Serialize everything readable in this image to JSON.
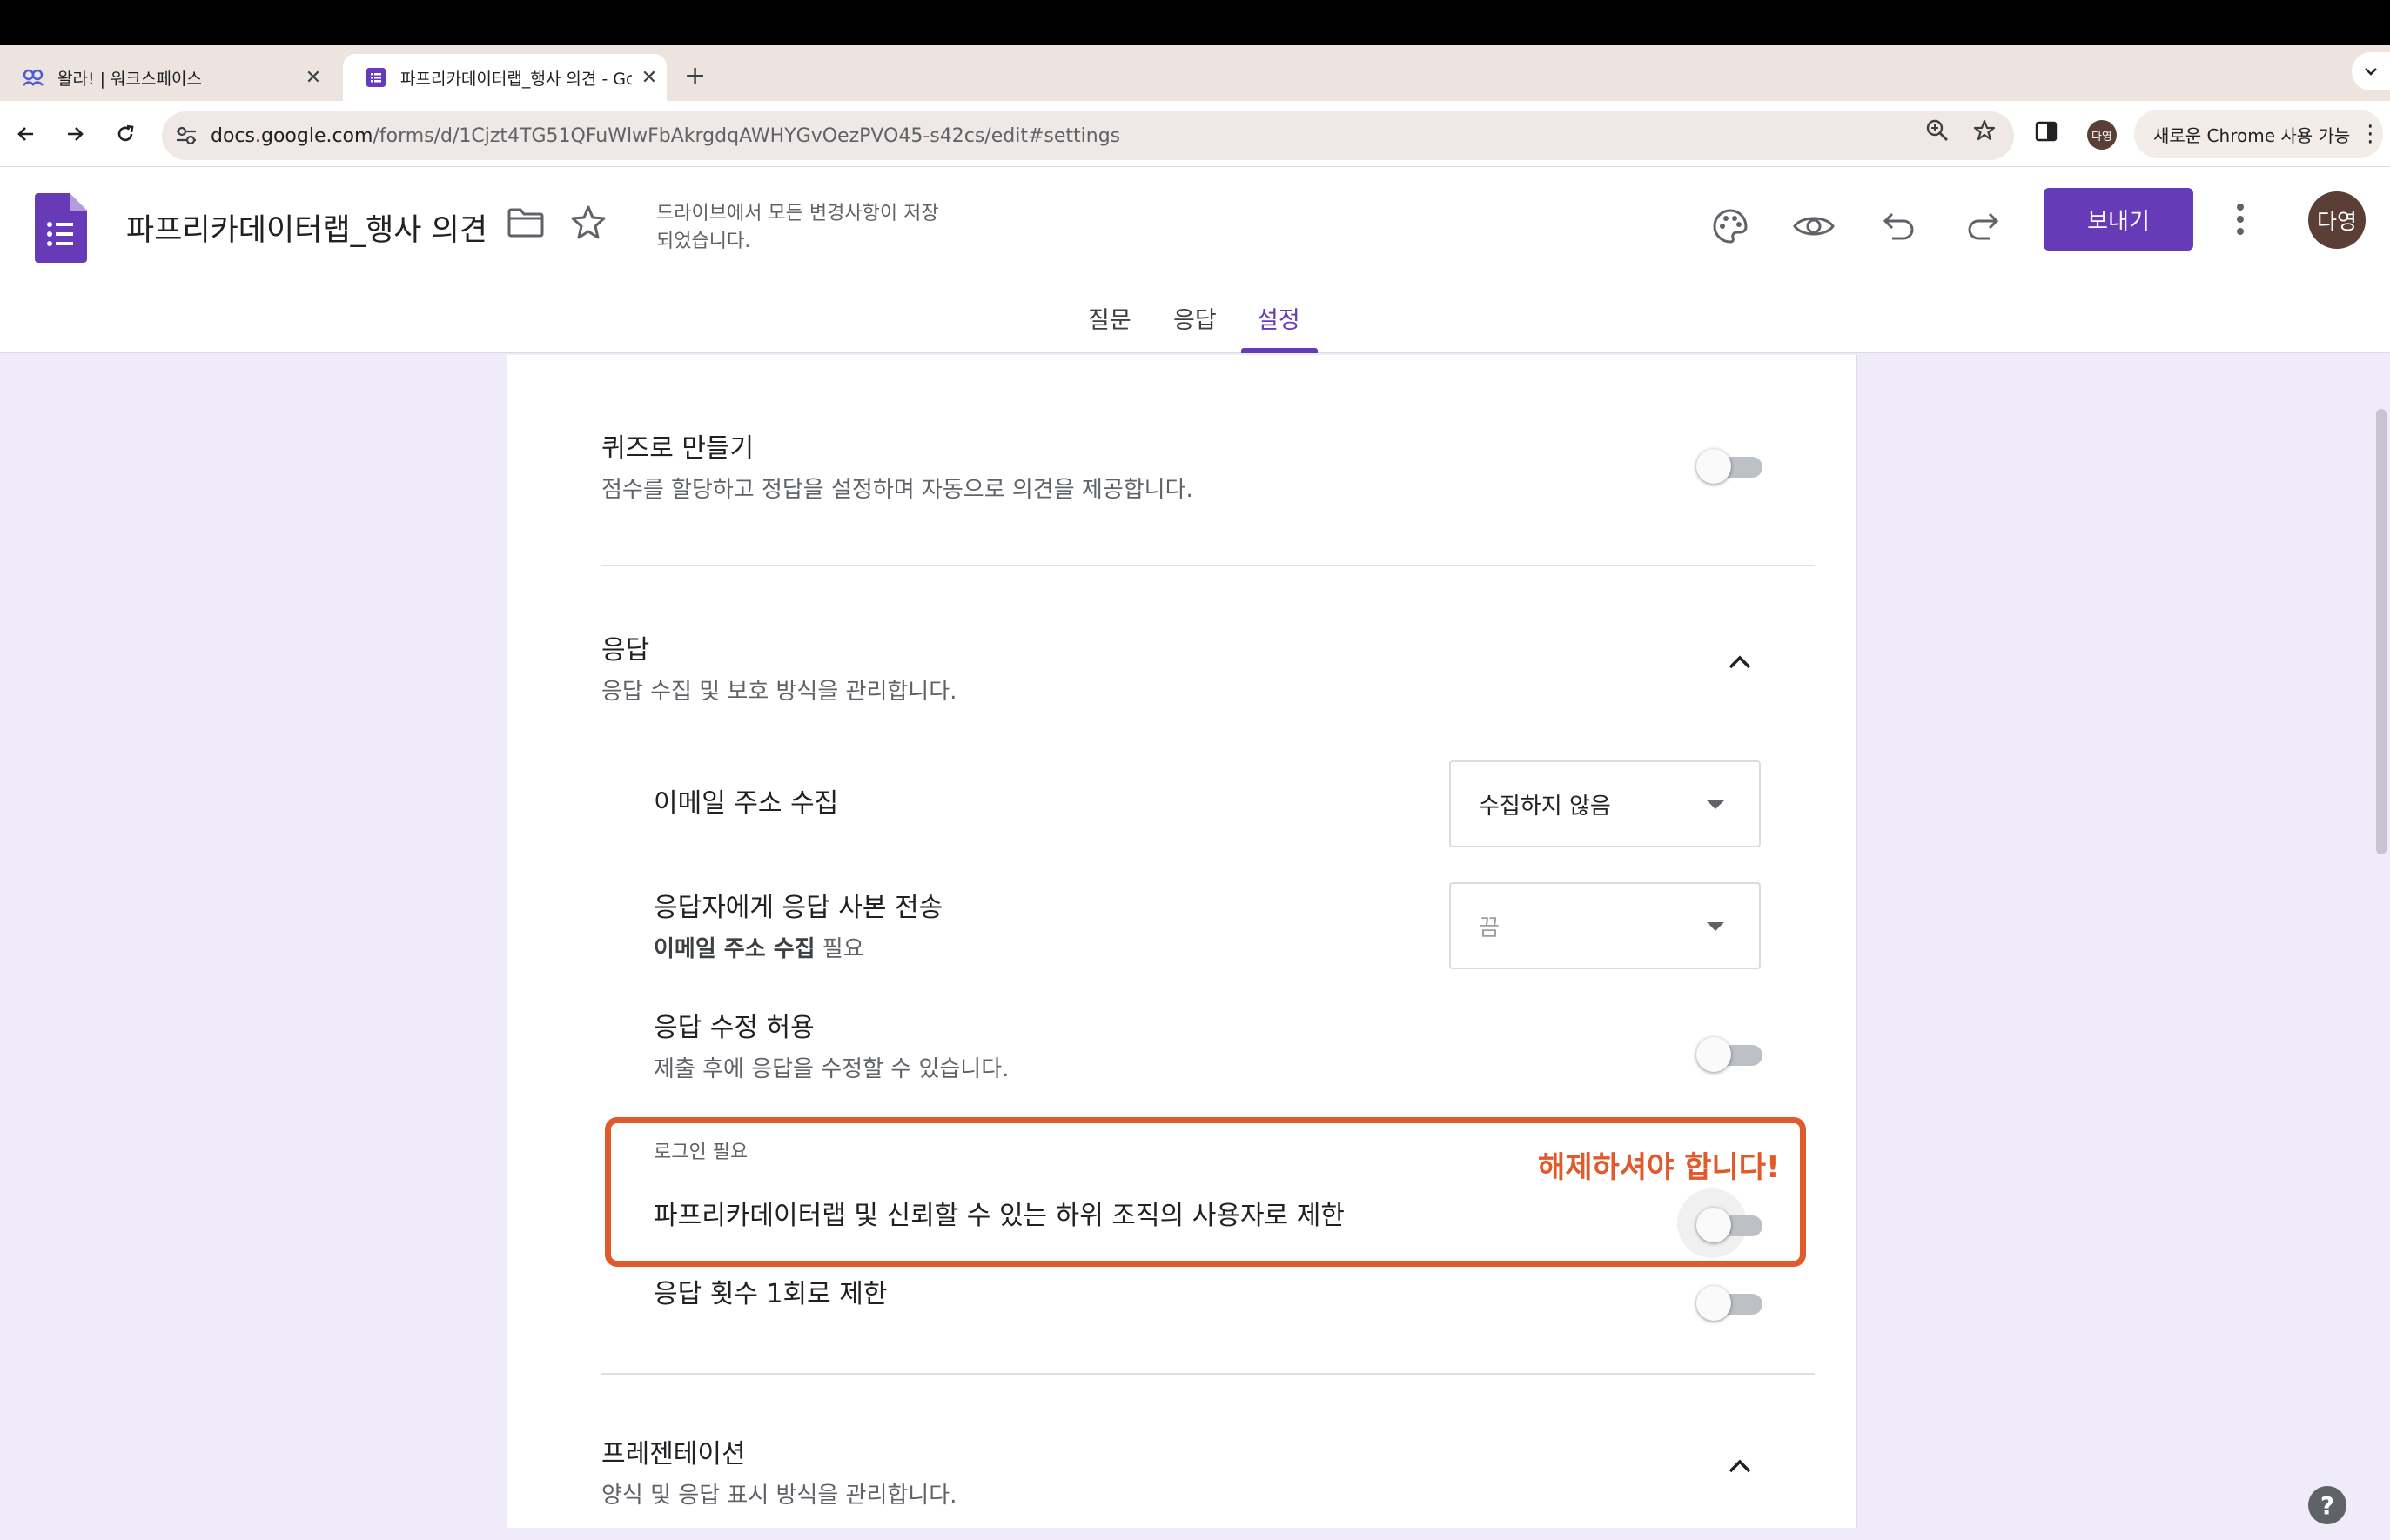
{
  "browser": {
    "tabs": [
      {
        "label": "왈라! | 워크스페이스",
        "icon": "workspace-icon"
      },
      {
        "label": "파프리카데이터랩_행사 의견 - Go",
        "icon": "google-forms-icon"
      }
    ],
    "url_domain": "docs.google.com",
    "url_path": "/forms/d/1Cjzt4TG51QFuWlwFbAkrgdqAWHYGvOezPVO45-s42cs/edit#settings",
    "profile_initials": "다영",
    "chrome_update_label": "새로운 Chrome 사용 가능"
  },
  "header": {
    "doc_title": "파프리카데이터랩_행사 의견",
    "saved_status": "드라이브에서 모든 변경사항이 저장되었습니다.",
    "send_label": "보내기",
    "avatar_initials": "다영",
    "tabs": [
      {
        "label": "질문"
      },
      {
        "label": "응답"
      },
      {
        "label": "설정",
        "active": true
      }
    ]
  },
  "settings": {
    "quiz": {
      "title": "퀴즈로 만들기",
      "description": "점수를 할당하고 정답을 설정하며 자동으로 의견을 제공합니다.",
      "enabled": false
    },
    "responses": {
      "title": "응답",
      "description": "응답 수집 및 보호 방식을 관리합니다.",
      "collect_email": {
        "label": "이메일 주소 수집",
        "value": "수집하지 않음"
      },
      "send_copy": {
        "label": "응답자에게 응답 사본 전송",
        "note_bold": "이메일 주소 수집",
        "note_rest": " 필요",
        "value": "끔"
      },
      "allow_edit": {
        "label": "응답 수정 허용",
        "description": "제출 후에 응답을 수정할 수 있습니다.",
        "enabled": false
      },
      "login_required": {
        "section_label": "로그인 필요",
        "label": "파프리카데이터랩 및 신뢰할 수 있는 하위 조직의 사용자로 제한",
        "enabled": false
      },
      "limit_one": {
        "label": "응답 횟수 1회로 제한",
        "enabled": false
      }
    },
    "presentation": {
      "title": "프레젠테이션",
      "description": "양식 및 응답 표시 방식을 관리합니다."
    }
  },
  "annotation": {
    "text": "해제하셔야 합니다!",
    "color": "#e15a2c"
  },
  "colors": {
    "brand": "#673ab7",
    "page_bg": "#f0ebf8"
  }
}
